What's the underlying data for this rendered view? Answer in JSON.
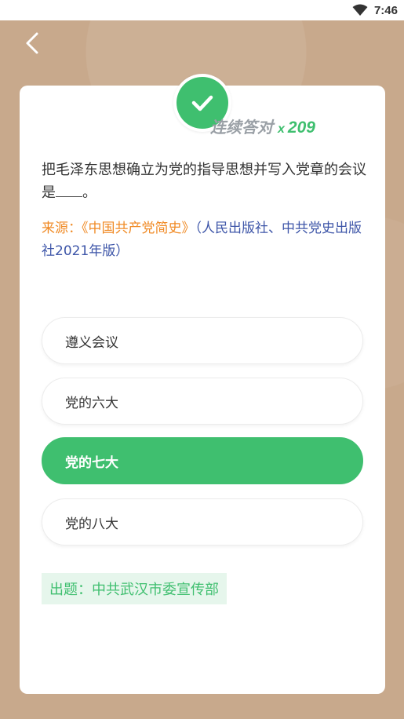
{
  "status_bar": {
    "time": "7:46",
    "icons": [
      "wifi-icon"
    ]
  },
  "header": {
    "back_icon": "chevron-left-icon"
  },
  "badge": {
    "icon": "check-icon"
  },
  "streak": {
    "label": "连续答对",
    "multiplier": "x",
    "count": "209"
  },
  "question": {
    "text_before": "把毛泽东思想确立为党的指导思想并写入党章的会议是",
    "text_after": "。"
  },
  "source": {
    "label": "来源：",
    "book": "《中国共产党简史》",
    "publisher": "（人民出版社、中共党史出版社2021年版）"
  },
  "options": [
    {
      "label": "遵义会议",
      "selected": false
    },
    {
      "label": "党的六大",
      "selected": false
    },
    {
      "label": "党的七大",
      "selected": true
    },
    {
      "label": "党的八大",
      "selected": false
    }
  ],
  "author": {
    "text": "出题：中共武汉市委宣传部"
  },
  "colors": {
    "background": "#c8a98c",
    "accent_green": "#3fbf6f",
    "source_orange": "#f08a24",
    "source_blue": "#3d55a8"
  }
}
